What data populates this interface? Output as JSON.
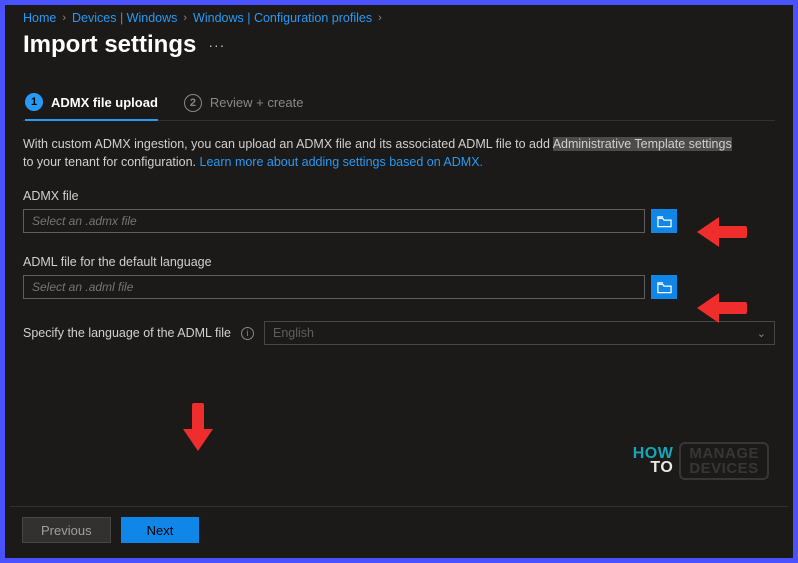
{
  "breadcrumb": {
    "items": [
      "Home",
      "Devices | Windows",
      "Windows | Configuration profiles"
    ]
  },
  "page": {
    "title": "Import settings",
    "more": "···"
  },
  "tabs": {
    "step1_num": "1",
    "step1_label": "ADMX file upload",
    "step2_num": "2",
    "step2_label": "Review + create"
  },
  "intro": {
    "text_before": "With custom ADMX ingestion, you can upload an ADMX file and its associated ADML file to add ",
    "highlight": "Administrative Template settings",
    "text_after": " to your tenant for configuration. ",
    "link": "Learn more about adding settings based on ADMX."
  },
  "fields": {
    "admx_label": "ADMX file",
    "admx_placeholder": "Select an .admx file",
    "adml_label": "ADML file for the default language",
    "adml_placeholder": "Select an .adml file",
    "lang_label": "Specify the language of the ADML file",
    "lang_value": "English"
  },
  "buttons": {
    "previous": "Previous",
    "next": "Next"
  },
  "watermark": {
    "how": "HOW",
    "to": "TO",
    "box1": "MANAGE",
    "box2": "DEVICES"
  },
  "icons": {
    "folder": "folder-icon",
    "info": "i"
  }
}
